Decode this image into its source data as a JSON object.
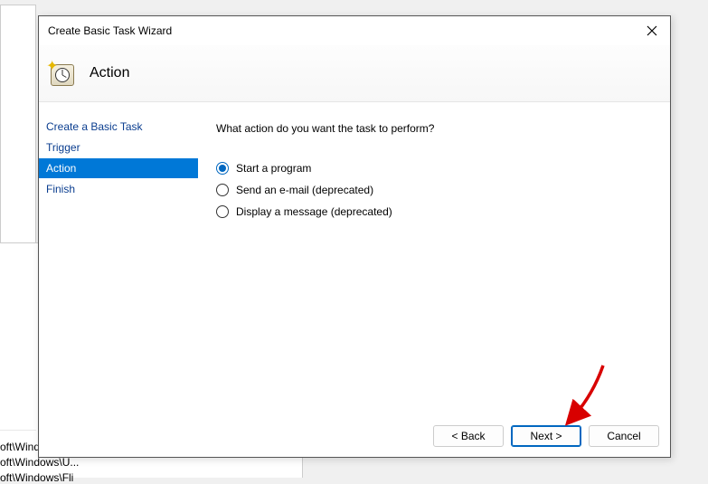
{
  "background": {
    "line1": "oft\\Windo",
    "line2": "oft\\Windows\\U...",
    "line3": "oft\\Windows\\Fli"
  },
  "dialog": {
    "title": "Create Basic Task Wizard",
    "header": "Action",
    "prompt": "What action do you want the task to perform?",
    "options": {
      "opt0": {
        "label": "Start a program",
        "checked": true
      },
      "opt1": {
        "label": "Send an e-mail (deprecated)",
        "checked": false
      },
      "opt2": {
        "label": "Display a message (deprecated)",
        "checked": false
      }
    },
    "sidebar": {
      "s0": "Create a Basic Task",
      "s1": "Trigger",
      "s2": "Action",
      "s3": "Finish"
    },
    "buttons": {
      "back": "< Back",
      "next": "Next >",
      "cancel": "Cancel"
    }
  }
}
